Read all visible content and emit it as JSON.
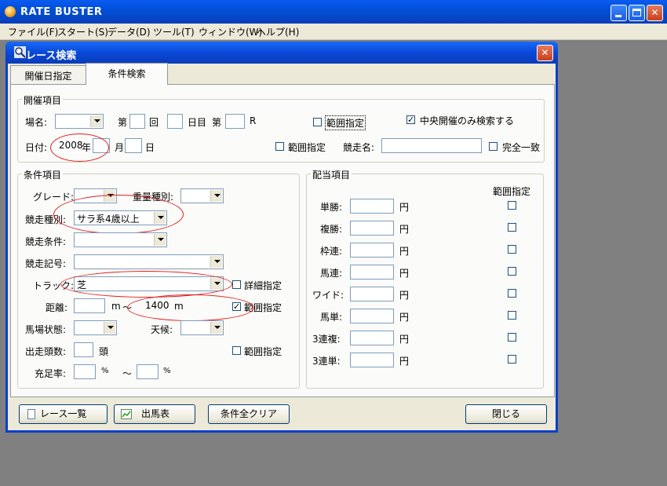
{
  "app": {
    "title": "RATE BUSTER"
  },
  "menu": [
    "ファイル(F)",
    "スタート(S)",
    "データ(D)",
    "ツール(T)",
    "ウィンドウ(W)",
    "ヘルプ(H)"
  ],
  "dialog": {
    "title": "レース検索"
  },
  "tabs": [
    "開催日指定",
    "条件検索"
  ],
  "kaisai": {
    "legend": "開催項目",
    "place_label": "場名:",
    "dai_label": "第",
    "kai_label": "回",
    "nichime_label": "日目",
    "dai2_label": "第",
    "r_label": "R",
    "range_label": "範囲指定",
    "central_label": "中央開催のみ検索する",
    "central_checked": true,
    "date_label": "日付:",
    "year_value": "2008",
    "year_label": "年",
    "month_label": "月",
    "day_label": "日",
    "range2_label": "範囲指定",
    "race_name_label": "競走名:",
    "exact_label": "完全一致"
  },
  "joken": {
    "legend": "条件項目",
    "grade_label": "グレード:",
    "weight_label": "重量種別:",
    "race_type_label": "競走種別:",
    "race_type_value": "サラ系4歳以上",
    "race_cond_label": "競走条件:",
    "race_sign_label": "競走記号:",
    "track_label": "トラック:",
    "track_value": "芝",
    "detail_label": "詳細指定",
    "distance_label": "距離:",
    "m1": "m",
    "tilde": "～",
    "distance_to": "1400",
    "m2": "m",
    "dist_range_label": "範囲指定",
    "dist_range_checked": true,
    "baba_label": "馬場状態:",
    "weather_label": "天候:",
    "runners_label": "出走頭数:",
    "runners_unit": "頭",
    "runners_range_label": "範囲指定",
    "fill_label": "充足率:",
    "pct1": "%",
    "tilde2": "～",
    "pct2": "%"
  },
  "haito": {
    "legend": "配当項目",
    "range_header": "範囲指定",
    "yen": "円",
    "rows": [
      "単勝:",
      "複勝:",
      "枠連:",
      "馬連:",
      "ワイド:",
      "馬単:",
      "3連複:",
      "3連単:"
    ]
  },
  "buttons": {
    "race_list": "レース一覧",
    "shutuba": "出馬表",
    "clear": "条件全クリア",
    "close": "閉じる"
  },
  "colors": {
    "highlight": "#e02020",
    "titlebar": "#0a48d8"
  }
}
